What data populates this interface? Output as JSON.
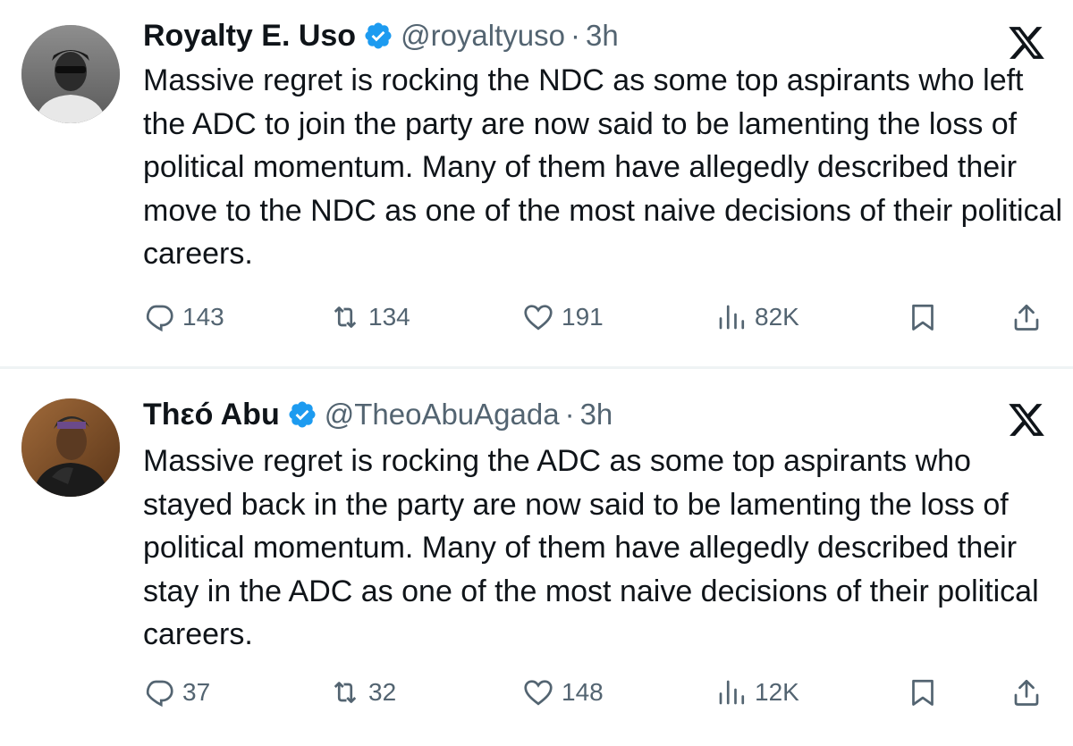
{
  "tweets": [
    {
      "display_name": "Royalty E. Uso",
      "handle": "@royaltyuso",
      "separator": "·",
      "time": "3h",
      "text": "Massive regret is rocking the NDC as some top aspirants who left the ADC to join the party are now said to be lamenting the loss of political momentum. Many of them have allegedly described their move to the NDC as one of the most naive decisions of their political careers.",
      "replies": "143",
      "reposts": "134",
      "likes": "191",
      "views": "82K",
      "verified": true,
      "icons": {
        "reply": "reply-icon",
        "repost": "repost-icon",
        "like": "heart-icon",
        "views": "views-icon",
        "bookmark": "bookmark-icon",
        "share": "share-icon",
        "platform": "x-logo-icon"
      }
    },
    {
      "display_name": "Thεó Abu",
      "handle": "@TheoAbuAgada",
      "separator": "·",
      "time": "3h",
      "text": "Massive regret is rocking the ADC as some top aspirants who stayed back in the party are now said to be lamenting the loss of political momentum. Many of them have allegedly described their stay in the ADC as one of the most naive decisions of their political careers.",
      "replies": "37",
      "reposts": "32",
      "likes": "148",
      "views": "12K",
      "verified": true,
      "icons": {
        "reply": "reply-icon",
        "repost": "repost-icon",
        "like": "heart-icon",
        "views": "views-icon",
        "bookmark": "bookmark-icon",
        "share": "share-icon",
        "platform": "x-logo-icon"
      }
    }
  ],
  "colors": {
    "text_primary": "#0f1419",
    "text_secondary": "#536471",
    "verified_badge": "#1d9bf0",
    "divider": "#eff3f4"
  }
}
